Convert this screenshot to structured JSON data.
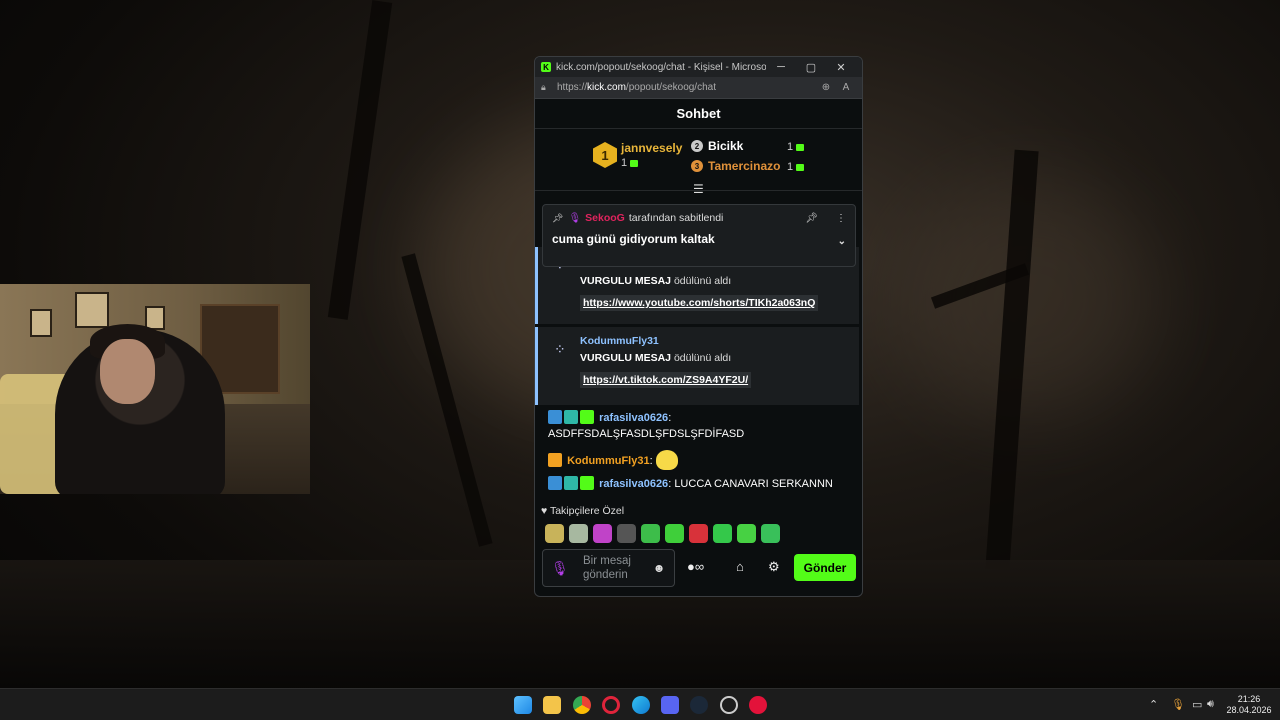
{
  "window": {
    "title": "kick.com/popout/sekoog/chat - Kişisel - Microsoft...",
    "url_prefix": "https://",
    "url_domain": "kick.com",
    "url_path": "/popout/sekoog/chat"
  },
  "chat": {
    "header": "Sohbet",
    "leaderboard": {
      "first": {
        "rank": "1",
        "name": "jannvesely",
        "count": "1"
      },
      "second": {
        "rank": "2",
        "name": "Bicikk",
        "count": "1"
      },
      "third": {
        "rank": "3",
        "name": "Tamercinazo",
        "count": "1"
      }
    },
    "pinned": {
      "user": "SekooG",
      "suffix": "tarafından sabitlendi",
      "message": "cuma günü gidiyorum kaltak"
    },
    "rewards": [
      {
        "user": "",
        "reward_name": "VURGULU MESAJ",
        "reward_suffix": "ödülünü aldı",
        "link": "https://www.youtube.com/shorts/TIKh2a063nQ"
      },
      {
        "user": "KodummuFly31",
        "reward_name": "VURGULU MESAJ",
        "reward_suffix": "ödülünü aldı",
        "link": "https://vt.tiktok.com/ZS9A4YF2U/"
      }
    ],
    "messages": [
      {
        "user": "rafasilva0626",
        "sep": ":",
        "text": "ASDFFSDALŞFASDLŞFDSLŞFDİFASD",
        "color": "#8ec2ff"
      },
      {
        "user": "KodummuFly31",
        "sep": ":",
        "text": "",
        "color": "#f2a122"
      },
      {
        "user": "rafasilva0626",
        "sep": ":",
        "text": "LUCCA CANAVARI SERKANNN",
        "color": "#8ec2ff"
      }
    ],
    "follower_label": "Takipçilere Özel",
    "composer_placeholder": "Bir mesaj gönderin",
    "send_label": "Gönder"
  },
  "taskbar": {
    "time": "21:26",
    "date": "28.04.2026"
  },
  "colors": {
    "accent": "#53fc18",
    "pinned_user": "#e0245e",
    "first_place": "#e8b53a",
    "third_place": "#e0913a"
  }
}
